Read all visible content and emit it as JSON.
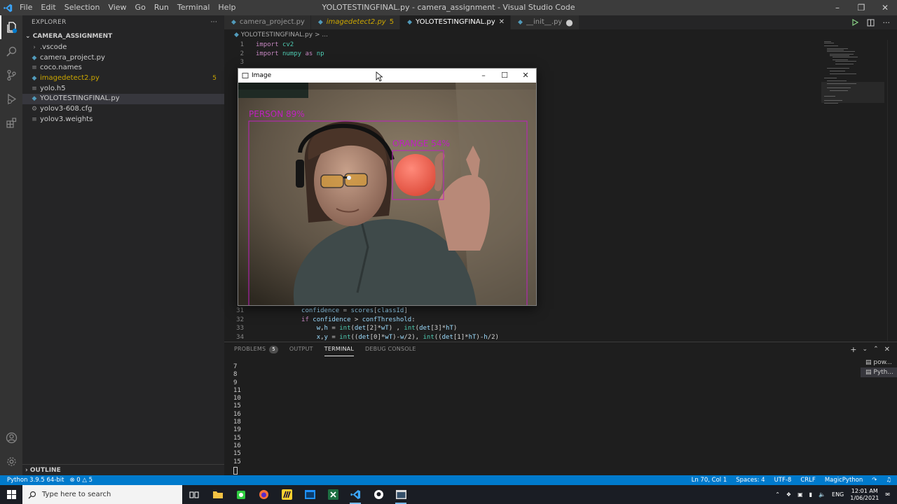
{
  "window": {
    "title": "YOLOTESTINGFINAL.py - camera_assignment - Visual Studio Code",
    "menu": [
      "File",
      "Edit",
      "Selection",
      "View",
      "Go",
      "Run",
      "Terminal",
      "Help"
    ]
  },
  "sidebar": {
    "header": "EXPLORER",
    "folder": "CAMERA_ASSIGNMENT",
    "files": [
      {
        "name": ".vscode",
        "icon": "chevron-right-icon",
        "color": "#cccccc"
      },
      {
        "name": "camera_project.py",
        "icon": "python-icon",
        "color": "#cccccc"
      },
      {
        "name": "coco.names",
        "icon": "file-lines-icon",
        "color": "#cccccc"
      },
      {
        "name": "imagedetect2.py",
        "icon": "python-icon",
        "color": "#cca700",
        "badge": "5"
      },
      {
        "name": "yolo.h5",
        "icon": "file-lines-icon",
        "color": "#cccccc"
      },
      {
        "name": "YOLOTESTINGFINAL.py",
        "icon": "python-icon",
        "color": "#cccccc",
        "selected": true
      },
      {
        "name": "yolov3-608.cfg",
        "icon": "gear-icon",
        "color": "#cccccc"
      },
      {
        "name": "yolov3.weights",
        "icon": "file-lines-icon",
        "color": "#cccccc"
      }
    ],
    "outline": "OUTLINE"
  },
  "tabs": [
    {
      "label": "camera_project.py",
      "active": false
    },
    {
      "label": "imagedetect2.py",
      "active": false,
      "modified": true,
      "badge": "5"
    },
    {
      "label": "YOLOTESTINGFINAL.py",
      "active": true
    },
    {
      "label": "__init__.py",
      "active": false,
      "dirty": true
    }
  ],
  "breadcrumb": {
    "file": "YOLOTESTINGFINAL.py",
    "sep": ">",
    "rest": "..."
  },
  "editor": {
    "top_lines": [
      {
        "n": "1",
        "code": "import cv2"
      },
      {
        "n": "2",
        "code": "import numpy as np"
      },
      {
        "n": "3",
        "code": ""
      }
    ],
    "bottom_lines": [
      {
        "n": "31",
        "code": "            confidence = scores[classId]"
      },
      {
        "n": "32",
        "code": "            if confidence > confThreshold:"
      },
      {
        "n": "33",
        "code": "                w,h = int(det[2]*wT) , int(det[3]*hT)"
      },
      {
        "n": "34",
        "code": "                x,y = int((det[0]*wT)-w/2), int((det[1]*hT)-h/2)"
      }
    ]
  },
  "image_window": {
    "title": "Image",
    "detections": [
      {
        "label": "PERSON 89%",
        "color": "#c020c0"
      },
      {
        "label": "ORANGE 54%",
        "color": "#c020c0"
      }
    ]
  },
  "panel": {
    "tabs": [
      {
        "label": "PROBLEMS",
        "badge": "5"
      },
      {
        "label": "OUTPUT"
      },
      {
        "label": "TERMINAL",
        "active": true
      },
      {
        "label": "DEBUG CONSOLE"
      }
    ],
    "terminal_output": [
      "7",
      "8",
      "9",
      "11",
      "10",
      "15",
      "16",
      "18",
      "19",
      "15",
      "16",
      "15",
      "15"
    ],
    "terminals": [
      {
        "label": "pow...",
        "selected": false
      },
      {
        "label": "Pyth...",
        "selected": true
      }
    ]
  },
  "statusbar": {
    "interpreter": "Python 3.9.5 64-bit",
    "errors": "0",
    "warnings": "5",
    "position": "Ln 70, Col 1",
    "spaces": "Spaces: 4",
    "encoding": "UTF-8",
    "eol": "CRLF",
    "language": "MagicPython"
  },
  "taskbar": {
    "search_placeholder": "Type here to search",
    "language": "ENG",
    "time": "12:01 AM",
    "date": "1/06/2021"
  },
  "colors": {
    "accent": "#007acc",
    "modified": "#cca700",
    "detection_box": "#c020c0"
  }
}
